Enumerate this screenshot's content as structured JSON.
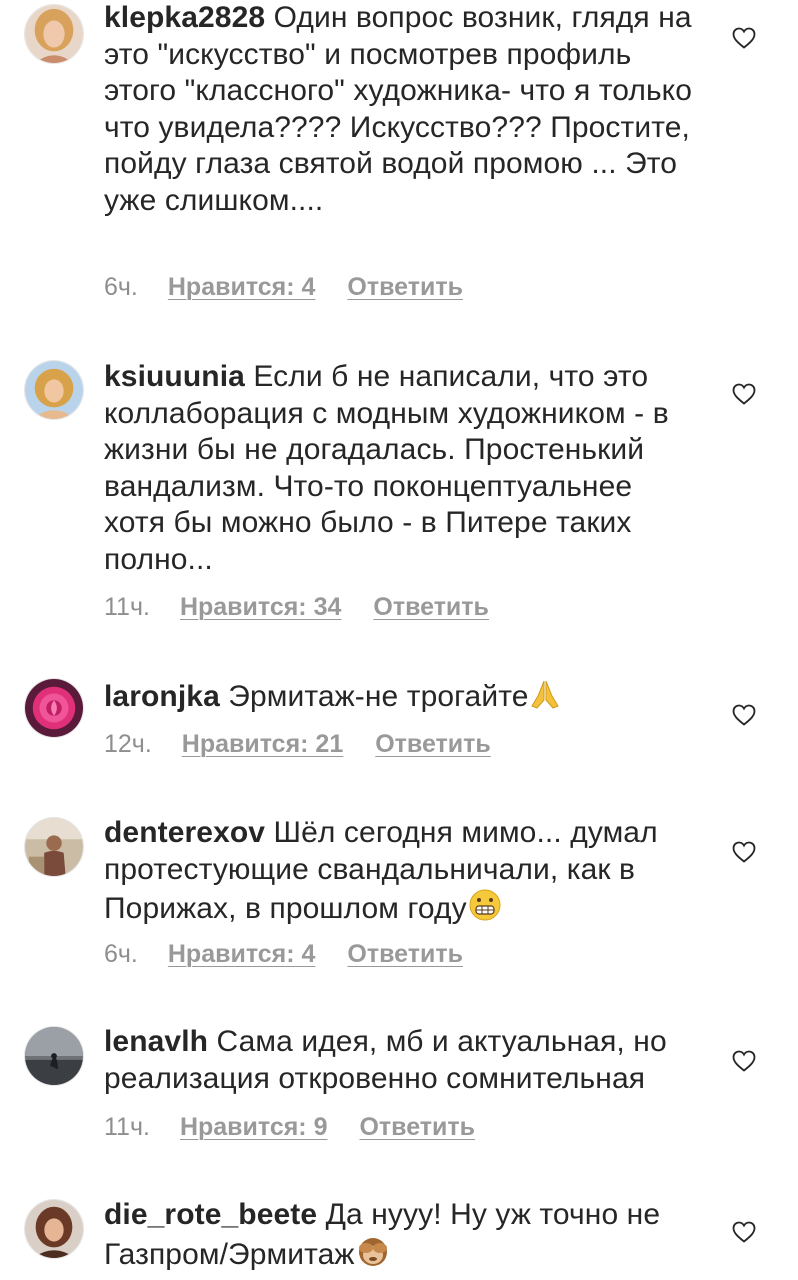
{
  "comments": [
    {
      "username": "klepka2828",
      "text": " Один вопрос возник, глядя на это \"искусство\" и посмотрев профиль этого \"классного\" художника- что я только что увидела???? Искусство??? Простите, пойду глаза святой водой промою ... Это уже слишком....",
      "time": "6ч.",
      "likes": "Нравится: 4",
      "reply": "Ответить"
    },
    {
      "username": "ksiuuunia",
      "text": " Если б не написали, что это коллаборация с модным художником - в жизни бы не догадалась. Простенький вандализм. Что-то поконцептуальнее хотя бы можно было - в Питере таких полно...",
      "time": "11ч.",
      "likes": "Нравится: 34",
      "reply": "Ответить"
    },
    {
      "username": "laronjka",
      "text": " Эрмитаж-не трогайте",
      "emoji": "praying-hands-emoji",
      "time": "12ч.",
      "likes": "Нравится: 21",
      "reply": "Ответить"
    },
    {
      "username": "denterexov",
      "text": " Шёл сегодня мимо... думал протестующие свандальничали, как в Порижах, в прошлом году",
      "emoji": "grimacing-face-emoji",
      "time": "6ч.",
      "likes": "Нравится: 4",
      "reply": "Ответить"
    },
    {
      "username": "lenavlh",
      "text": " Сама идея, мб и актуальная, но реализация откровенно сомнительная",
      "time": "11ч.",
      "likes": "Нравится: 9",
      "reply": "Ответить"
    },
    {
      "username": "die_rote_beete",
      "text": " Да нууу! Ну уж точно не Газпром/Эрмитаж",
      "emoji": "see-no-evil-monkey-emoji",
      "time": "",
      "likes": "",
      "reply": ""
    }
  ],
  "icons": {
    "like": "heart-outline-icon"
  },
  "colors": {
    "text": "#262626",
    "meta": "#8e8e8e",
    "background": "#ffffff"
  }
}
